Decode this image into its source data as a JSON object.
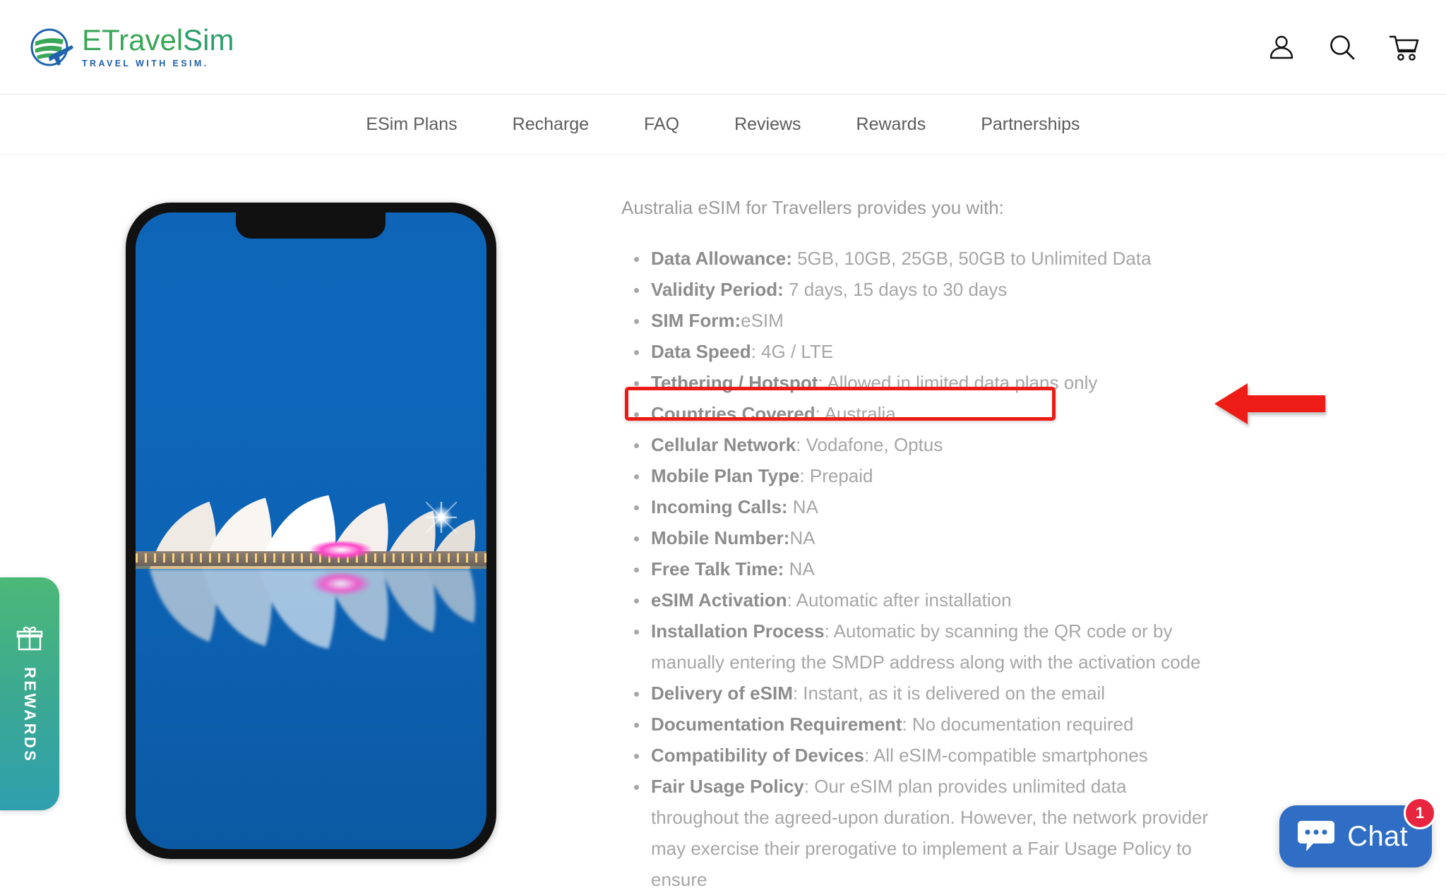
{
  "brand": {
    "name_part1": "E",
    "name_part2": "Travel",
    "name_part3": "Sim",
    "tagline": "TRAVEL WITH ESIM.",
    "logo_icon": "globe-plane-icon"
  },
  "header": {
    "icons": [
      {
        "name": "account-icon",
        "label": "Account"
      },
      {
        "name": "search-icon",
        "label": "Search"
      },
      {
        "name": "cart-icon",
        "label": "Cart"
      }
    ]
  },
  "nav": {
    "items": [
      {
        "label": "ESim Plans"
      },
      {
        "label": "Recharge"
      },
      {
        "label": "FAQ"
      },
      {
        "label": "Reviews"
      },
      {
        "label": "Rewards"
      },
      {
        "label": "Partnerships"
      }
    ]
  },
  "product_image": {
    "alt": "Sydney Opera House at dusk on smartphone screen",
    "device": "smartphone-mockup"
  },
  "content": {
    "intro": "Australia eSIM for Travellers provides you with:",
    "specs": [
      {
        "label": "Data Allowance:",
        "value": " 5GB, 10GB, 25GB, 50GB to Unlimited Data"
      },
      {
        "label": "Validity Period:",
        "value": " 7 days, 15 days to 30 days"
      },
      {
        "label": "SIM Form:",
        "value": "eSIM"
      },
      {
        "label": "Data Speed",
        "value": ": 4G / LTE"
      },
      {
        "label": "Tethering / Hotspot",
        "value": ": Allowed in limited data plans only",
        "highlighted": true
      },
      {
        "label": "Countries Covered",
        "value": ": Australia"
      },
      {
        "label": "Cellular Network",
        "value": ": Vodafone, Optus"
      },
      {
        "label": "Mobile Plan Type",
        "value": ": Prepaid"
      },
      {
        "label": "Incoming Calls:",
        "value": " NA"
      },
      {
        "label": "Mobile Number:",
        "value": "NA"
      },
      {
        "label": "Free Talk Time:",
        "value": " NA"
      },
      {
        "label": "eSIM Activation",
        "value": ": Automatic after installation"
      },
      {
        "label": "Installation Process",
        "value": ": Automatic by scanning the QR code or by manually entering the SMDP address along with the activation code"
      },
      {
        "label": "Delivery of eSIM",
        "value": ": Instant, as it is delivered on the email"
      },
      {
        "label": "Documentation Requirement",
        "value": ": No documentation required"
      },
      {
        "label": "Compatibility of Devices",
        "value": ": All eSIM-compatible smartphones"
      },
      {
        "label": "Fair Usage Policy",
        "value": ": Our eSIM plan provides unlimited data throughout the agreed-upon duration. However, the network provider may exercise their prerogative to implement a Fair Usage Policy to ensure"
      }
    ]
  },
  "annotations": {
    "highlight_color": "#ee1b14",
    "arrow_color": "#ee1b14",
    "arrow_direction": "left",
    "target": "Tethering / Hotspot"
  },
  "rewards_tab": {
    "label": "REWARDS",
    "icon": "gift-icon",
    "gradient_start": "#4cb878",
    "gradient_end": "#2f9fae"
  },
  "chat_widget": {
    "label": "Chat",
    "badge_count": "1",
    "icon": "chat-bubble-icon",
    "background": "#2f6ec4",
    "badge_color": "#e8253e"
  }
}
